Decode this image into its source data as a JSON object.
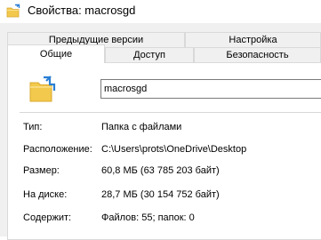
{
  "window": {
    "title": "Свойства: macrosgd"
  },
  "tabs": {
    "row1": [
      {
        "label": "Предыдущие версии"
      },
      {
        "label": "Настройка"
      }
    ],
    "row2": [
      {
        "label": "Общие",
        "active": true
      },
      {
        "label": "Доступ"
      },
      {
        "label": "Безопасность"
      }
    ]
  },
  "general": {
    "folder_icon": "folder-cloud-sync-icon",
    "name": "macrosgd",
    "properties": [
      {
        "label": "Тип:",
        "value": "Папка с файлами"
      },
      {
        "label": "Расположение:",
        "value": "C:\\Users\\prots\\OneDrive\\Desktop"
      },
      {
        "label": "Размер:",
        "value": "60,8 МБ (63 785 203 байт)"
      },
      {
        "label": "На диске:",
        "value": "28,7 МБ (30 154 752 байт)"
      },
      {
        "label": "Содержит:",
        "value": "Файлов: 55; папок: 0"
      }
    ]
  },
  "colors": {
    "folder": "#f2c94c",
    "sync_arrows": "#2a7fd4",
    "dialog_background": "#f0f0f0"
  }
}
